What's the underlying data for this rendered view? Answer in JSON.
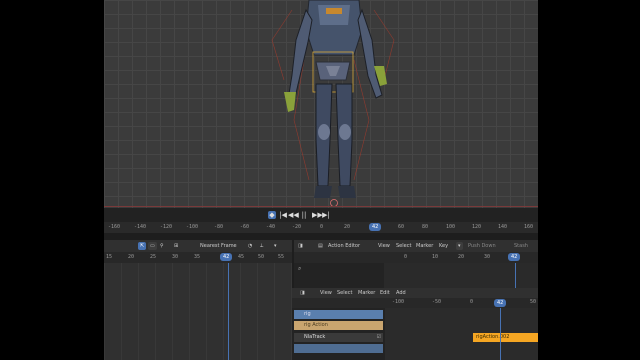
{
  "playback": {
    "controls": [
      "◆",
      "|◀",
      "◀◀",
      "||",
      "▶▶",
      "▶|"
    ]
  },
  "timeline_ruler": {
    "ticks": [
      "-160",
      "-140",
      "-120",
      "-100",
      "-80",
      "-60",
      "-40",
      "-20",
      "0",
      "20",
      "40",
      "60",
      "80",
      "100",
      "120",
      "140",
      "160"
    ],
    "current_frame": "42"
  },
  "left_editor": {
    "header": {
      "snap_mode": "Nearest Frame"
    },
    "ruler": {
      "ticks": [
        "15",
        "20",
        "25",
        "30",
        "35",
        "40",
        "45",
        "50",
        "55"
      ],
      "current_frame": "42"
    }
  },
  "action_editor": {
    "header": {
      "editor_type": "Action Editor",
      "menus": [
        "View",
        "Select",
        "Marker",
        "Key"
      ],
      "push_down": "Push Down",
      "stash": "Stash"
    },
    "ruler": {
      "ticks": [
        "0",
        "10",
        "20",
        "30"
      ],
      "current_frame": "42"
    }
  },
  "dope_editor": {
    "header": {
      "menus": [
        "View",
        "Select",
        "Marker",
        "Edit",
        "Add"
      ]
    },
    "ruler": {
      "ticks": [
        "-100",
        "-50",
        "0",
        "50"
      ],
      "current_frame": "42"
    },
    "channels": [
      {
        "label": "rig",
        "kind": "summary"
      },
      {
        "label": "rig Action",
        "kind": "object"
      },
      {
        "label": "NlaTrack",
        "kind": "action"
      },
      {
        "label": "",
        "kind": "summary"
      }
    ],
    "strip_label": "rigAction.002"
  },
  "colors": {
    "accent": "#4772b3",
    "strip": "#f5a623",
    "viewport_bg": "#3b3b3b"
  }
}
